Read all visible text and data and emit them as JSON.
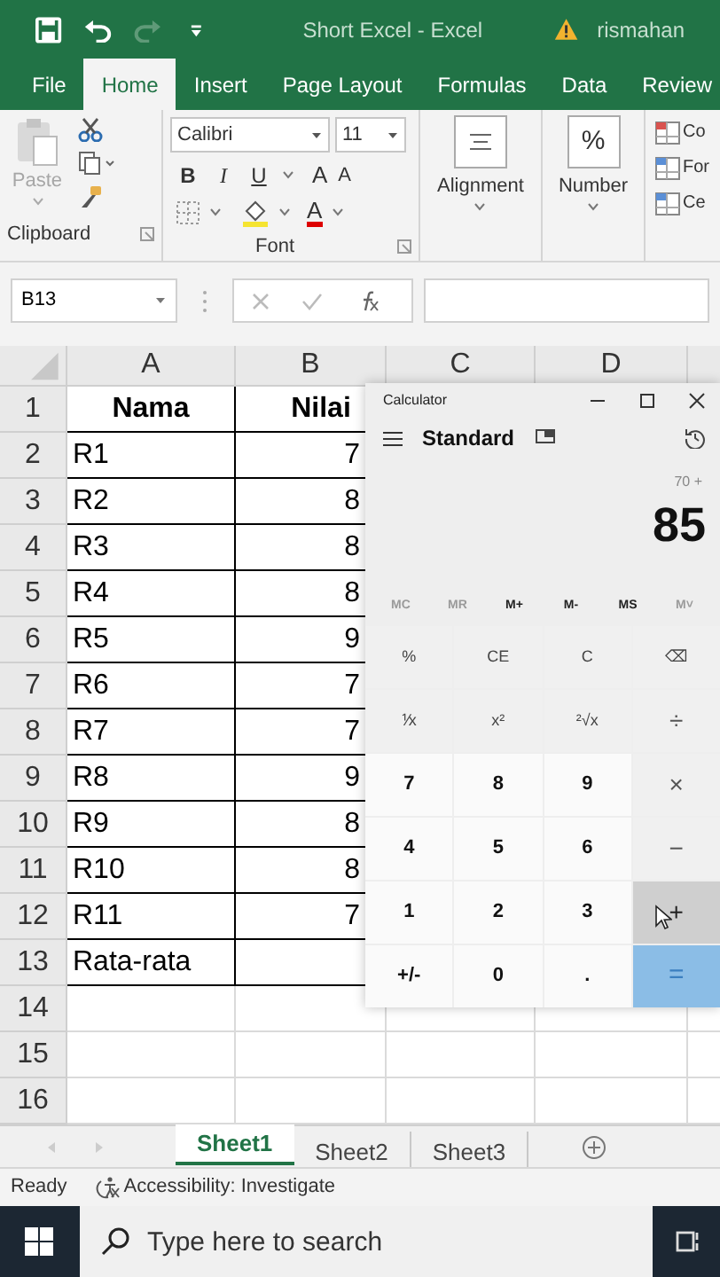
{
  "window": {
    "title": "Short Excel  -  Excel",
    "user": "rismahan"
  },
  "ribbon_tabs": [
    {
      "label": "File",
      "selected": false
    },
    {
      "label": "Home",
      "selected": true
    },
    {
      "label": "Insert",
      "selected": false
    },
    {
      "label": "Page Layout",
      "selected": false
    },
    {
      "label": "Formulas",
      "selected": false
    },
    {
      "label": "Data",
      "selected": false
    },
    {
      "label": "Review",
      "selected": false
    }
  ],
  "ribbon": {
    "clipboard": {
      "paste": "Paste",
      "label": "Clipboard"
    },
    "font": {
      "name": "Calibri",
      "size": "11",
      "styles": [
        "B",
        "I",
        "U"
      ],
      "grow": "A",
      "shrink": "A",
      "font_color": "A",
      "label": "Font"
    },
    "alignment": {
      "label": "Alignment"
    },
    "number": {
      "symbol": "%",
      "label": "Number"
    },
    "styles": [
      "Co",
      "For",
      "Ce"
    ]
  },
  "formula_bar": {
    "name_box": "B13"
  },
  "grid": {
    "columns": [
      "A",
      "B",
      "C",
      "D"
    ],
    "rows": [
      {
        "number": "1",
        "a": "Nama",
        "b": "Nilai",
        "header": true
      },
      {
        "number": "2",
        "a": "R1",
        "b": "7",
        "header": false
      },
      {
        "number": "3",
        "a": "R2",
        "b": "8",
        "header": false
      },
      {
        "number": "4",
        "a": "R3",
        "b": "8",
        "header": false
      },
      {
        "number": "5",
        "a": "R4",
        "b": "8",
        "header": false
      },
      {
        "number": "6",
        "a": "R5",
        "b": "9",
        "header": false
      },
      {
        "number": "7",
        "a": "R6",
        "b": "7",
        "header": false
      },
      {
        "number": "8",
        "a": "R7",
        "b": "7",
        "header": false
      },
      {
        "number": "9",
        "a": "R8",
        "b": "9",
        "header": false
      },
      {
        "number": "10",
        "a": "R9",
        "b": "8",
        "header": false
      },
      {
        "number": "11",
        "a": "R10",
        "b": "8",
        "header": false
      },
      {
        "number": "12",
        "a": "R11",
        "b": "7",
        "header": false
      },
      {
        "number": "13",
        "a": "Rata-rata",
        "header": false
      },
      {
        "number": "14"
      },
      {
        "number": "15"
      },
      {
        "number": "16"
      }
    ]
  },
  "sheet_tabs": [
    {
      "label": "Sheet1",
      "selected": true
    },
    {
      "label": "Sheet2",
      "selected": false
    },
    {
      "label": "Sheet3",
      "selected": false
    }
  ],
  "status_bar": {
    "mode": "Ready",
    "accessibility": "Accessibility: Investigate"
  },
  "taskbar": {
    "search_placeholder": "Type here to search"
  },
  "calculator": {
    "title": "Calculator",
    "mode": "Standard",
    "expression": "70 +",
    "display": "85",
    "memory": [
      {
        "label": "MC",
        "disabled": true
      },
      {
        "label": "MR",
        "disabled": true
      },
      {
        "label": "M+",
        "disabled": false
      },
      {
        "label": "M-",
        "disabled": false
      },
      {
        "label": "MS",
        "disabled": false
      },
      {
        "label": "M˅",
        "disabled": true
      }
    ],
    "buttons": [
      {
        "label": "%",
        "kind": "function",
        "hovered": false
      },
      {
        "label": "CE",
        "kind": "function",
        "hovered": false
      },
      {
        "label": "C",
        "kind": "function",
        "hovered": false
      },
      {
        "label": "⌫",
        "kind": "function",
        "hovered": false
      },
      {
        "label": "⅟x",
        "kind": "function",
        "hovered": false
      },
      {
        "label": "x²",
        "kind": "function",
        "hovered": false
      },
      {
        "label": "²√x",
        "kind": "function",
        "hovered": false
      },
      {
        "label": "÷",
        "kind": "operator",
        "hovered": false
      },
      {
        "label": "7",
        "kind": "digit",
        "hovered": false
      },
      {
        "label": "8",
        "kind": "digit",
        "hovered": false
      },
      {
        "label": "9",
        "kind": "digit",
        "hovered": false
      },
      {
        "label": "×",
        "kind": "operator",
        "hovered": false
      },
      {
        "label": "4",
        "kind": "digit",
        "hovered": false
      },
      {
        "label": "5",
        "kind": "digit",
        "hovered": false
      },
      {
        "label": "6",
        "kind": "digit",
        "hovered": false
      },
      {
        "label": "−",
        "kind": "operator",
        "hovered": false
      },
      {
        "label": "1",
        "kind": "digit",
        "hovered": false
      },
      {
        "label": "2",
        "kind": "digit",
        "hovered": false
      },
      {
        "label": "3",
        "kind": "digit",
        "hovered": false
      },
      {
        "label": "+",
        "kind": "operator",
        "hovered": true
      },
      {
        "label": "+/-",
        "kind": "digit",
        "hovered": false
      },
      {
        "label": "0",
        "kind": "digit",
        "hovered": false
      },
      {
        "label": ".",
        "kind": "digit",
        "hovered": false
      },
      {
        "label": "=",
        "kind": "equals",
        "hovered": false
      }
    ]
  }
}
